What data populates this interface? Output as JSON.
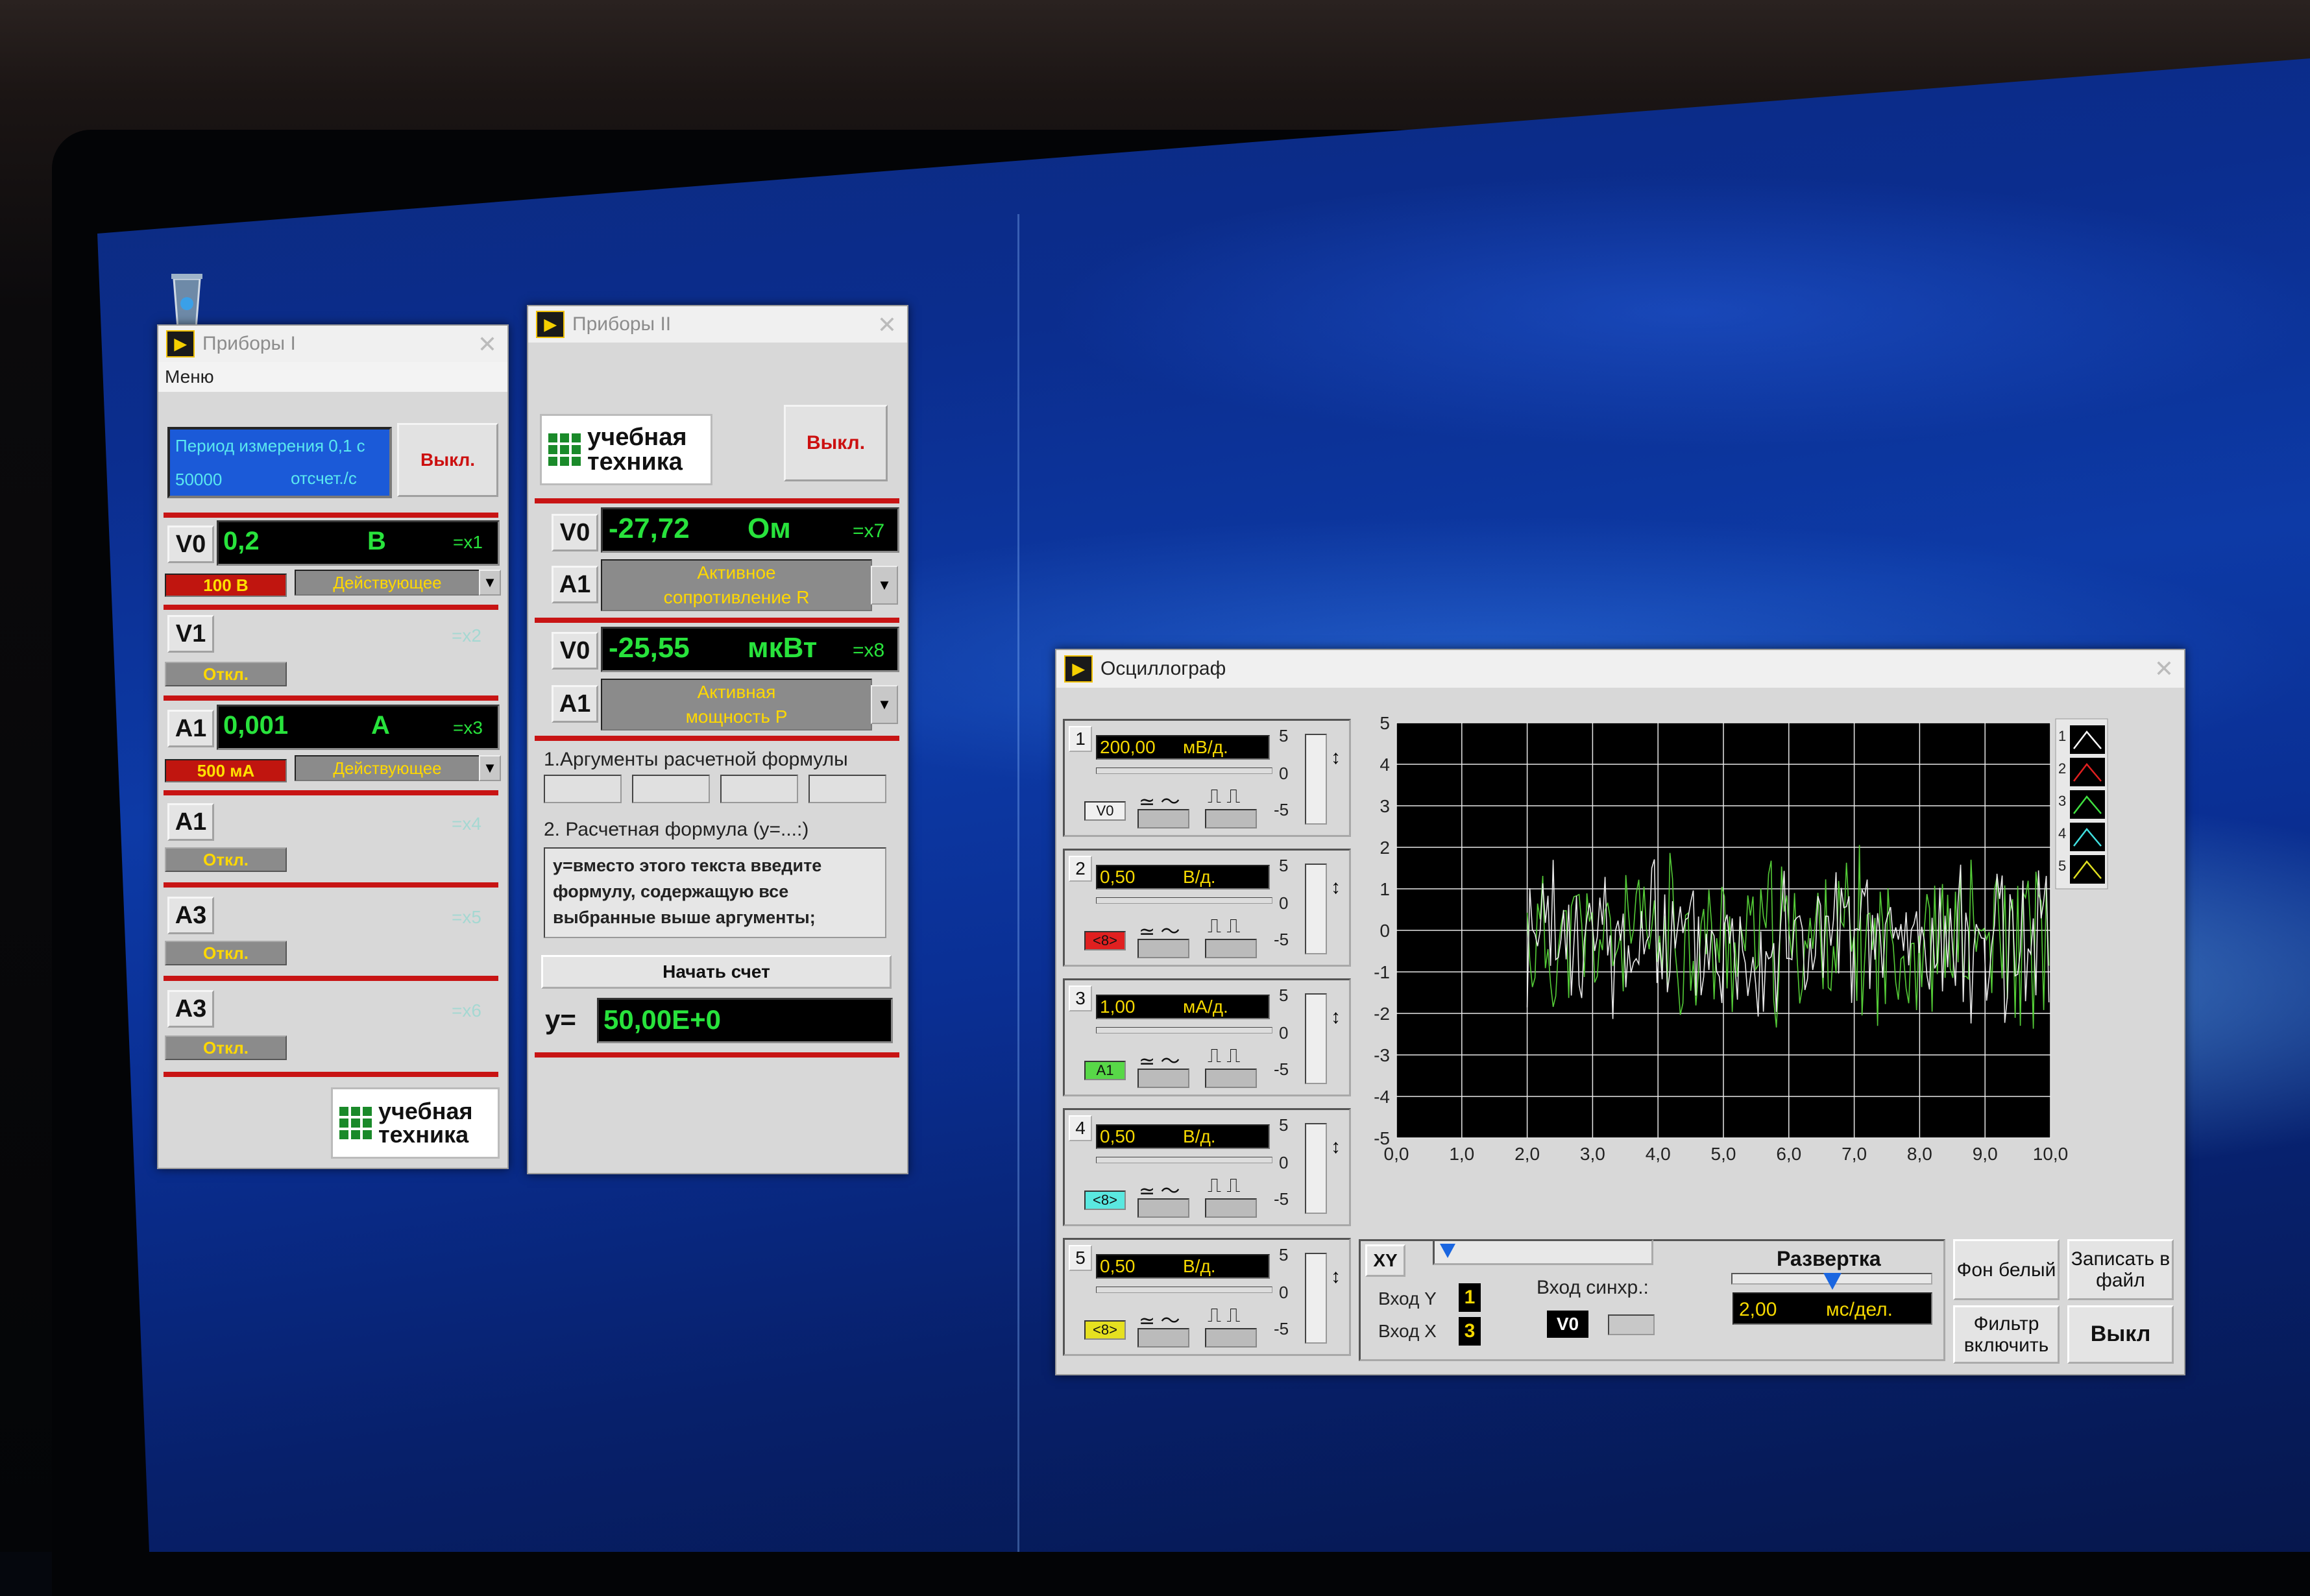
{
  "desktop": {
    "recycle_bin": "recycle-bin-icon"
  },
  "pribory1": {
    "title": "Приборы I",
    "menu": "Меню",
    "period_line1": "Период измерения 0,1 с",
    "period_count": "50000",
    "period_unit": "отсчет./с",
    "off_button": "Выкл.",
    "rows": [
      {
        "channel": "V0",
        "value": "0,2",
        "unit": "В",
        "xlabel": "=x1",
        "range": "100 В",
        "mode": "Действующее"
      },
      {
        "channel": "V1",
        "xlabel": "=x2",
        "state": "Откл."
      },
      {
        "channel": "A1",
        "value": "0,001",
        "unit": "А",
        "xlabel": "=x3",
        "range": "500 мА",
        "mode": "Действующее"
      },
      {
        "channel": "A1",
        "xlabel": "=x4",
        "state": "Откл."
      },
      {
        "channel": "A3",
        "xlabel": "=x5",
        "state": "Откл."
      },
      {
        "channel": "A3",
        "xlabel": "=x6",
        "state": "Откл."
      }
    ],
    "logo_line1": "учебная",
    "logo_line2": "техника"
  },
  "pribory2": {
    "title": "Приборы II",
    "logo_line1": "учебная",
    "logo_line2": "техника",
    "off_button": "Выкл.",
    "meters": [
      {
        "ch1": "V0",
        "value": "-27,72",
        "unit": "Ом",
        "xlabel": "=x7",
        "ch2": "A1",
        "param_line1": "Активное",
        "param_line2": "сопротивление  R"
      },
      {
        "ch1": "V0",
        "value": "-25,55",
        "unit": "мкВт",
        "xlabel": "=x8",
        "ch2": "A1",
        "param_line1": "Активная",
        "param_line2": "мощность  P"
      }
    ],
    "args_label": "1.Аргументы расчетной формулы",
    "formula_label": "2. Расчетная формула (y=...:)",
    "formula_text": "y=вместо этого текста введите формулу, содержащую все выбранные выше аргументы;",
    "start_button": "Начать счет",
    "y_label": "y=",
    "y_value": "50,00E+0"
  },
  "osc": {
    "title": "Осциллограф",
    "channels": [
      {
        "num": "1",
        "scale": "200,00",
        "unit": "мВ/д.",
        "tag": "V0",
        "tag_color": "#f0f0f0"
      },
      {
        "num": "2",
        "scale": "0,50",
        "unit": "В/д.",
        "tag": "<8>",
        "tag_color": "#e02020"
      },
      {
        "num": "3",
        "scale": "1,00",
        "unit": "мА/д.",
        "tag": "A1",
        "tag_color": "#58d848"
      },
      {
        "num": "4",
        "scale": "0,50",
        "unit": "В/д.",
        "tag": "<8>",
        "tag_color": "#5ae8e0"
      },
      {
        "num": "5",
        "scale": "0,50",
        "unit": "В/д.",
        "tag": "<8>",
        "tag_color": "#e6e020"
      }
    ],
    "mini_scale": [
      "5",
      "0",
      "-5"
    ],
    "y_ticks": [
      "5",
      "4",
      "3",
      "2",
      "1",
      "0",
      "-1",
      "-2",
      "-3",
      "-4",
      "-5"
    ],
    "x_ticks": [
      "0,0",
      "1,0",
      "2,0",
      "3,0",
      "4,0",
      "5,0",
      "6,0",
      "7,0",
      "8,0",
      "9,0",
      "10,0"
    ],
    "legend": [
      {
        "n": "1",
        "color": "#ffffff"
      },
      {
        "n": "2",
        "color": "#e02020"
      },
      {
        "n": "3",
        "color": "#40e040"
      },
      {
        "n": "4",
        "color": "#40e0e0"
      },
      {
        "n": "5",
        "color": "#e0e020"
      }
    ],
    "xy_label": "XY",
    "input_y_label": "Вход Y",
    "input_y_value": "1",
    "input_x_label": "Вход X",
    "input_x_value": "3",
    "sync_label": "Вход синхр.:",
    "sync_value": "V0",
    "sweep_label": "Развертка",
    "sweep_value": "2,00",
    "sweep_unit": "мс/дел.",
    "bg_button": "Фон белый",
    "save_button": "Записать в файл",
    "filter_button": "Фильтр включить",
    "off_button": "Выкл",
    "colors": {
      "white_trace": "#f4f4f4",
      "green_trace": "#59d63a",
      "grid": "#e8e8e8",
      "screen": "#000000"
    }
  }
}
